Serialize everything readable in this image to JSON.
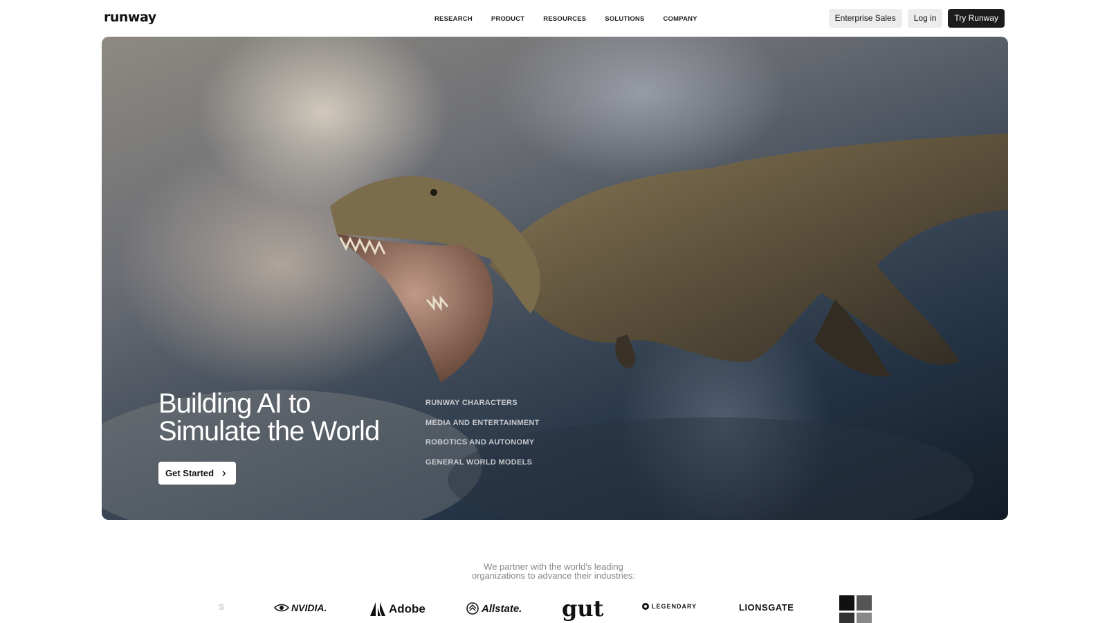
{
  "header": {
    "brand": "runway",
    "nav": [
      "RESEARCH",
      "PRODUCT",
      "RESOURCES",
      "SOLUTIONS",
      "COMPANY"
    ],
    "enterprise_label": "Enterprise Sales",
    "login_label": "Log in",
    "try_label": "Try Runway"
  },
  "hero": {
    "title": "Building AI to\nSimulate the World",
    "cta_label": "Get Started",
    "links": [
      "RUNWAY CHARACTERS",
      "MEDIA AND ENTERTAINMENT",
      "ROBOTICS AND AUTONOMY",
      "GENERAL WORLD MODELS"
    ]
  },
  "partners": {
    "text_line1": "We partner with the world's leading",
    "text_line2": "organizations to advance their industries:",
    "logos": [
      "NVIDIA.",
      "Adobe",
      "Allstate.",
      "gut",
      "LEGENDARY",
      "LIONSGATE"
    ]
  },
  "colors": {
    "primary_button": "#1c1c1c",
    "secondary_button": "#ececec",
    "partner_text": "#888888"
  }
}
